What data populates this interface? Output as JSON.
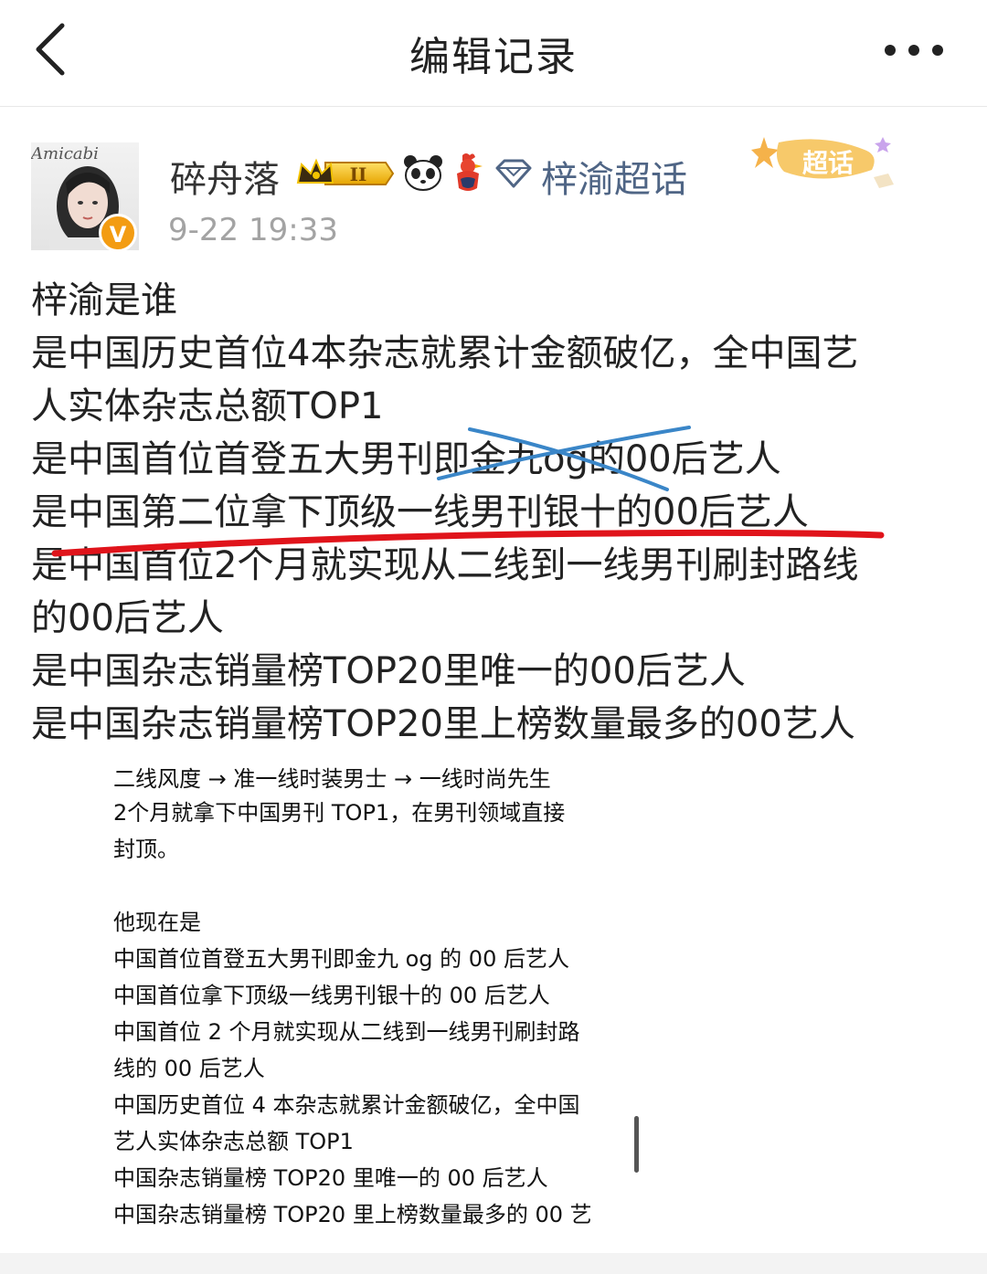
{
  "nav": {
    "title": "编辑记录",
    "back_icon": "chevron-left-icon",
    "more_icon": "more-dots-icon"
  },
  "post": {
    "avatar_text": "Amicabi",
    "verified_badge": "V",
    "username": "碎舟落",
    "level_badge": "II",
    "supertopic_label": "梓渝超话",
    "supertopic_sticker_label": "超话",
    "timestamp": "9-22 19:33",
    "accent_color": "#4f6585",
    "lines": [
      "梓渝是谁",
      "是中国历史首位4本杂志就累计金额破亿，全中国艺",
      "人实体杂志总额TOP1",
      "是中国首位首登五大男刊即金九og的00后艺人",
      "是中国第二位拿下顶级一线男刊银十的00后艺人",
      "是中国首位2个月就实现从二线到一线男刊刷封路线",
      "的00后艺人",
      "是中国杂志销量榜TOP20里唯一的00后艺人",
      "是中国杂志销量榜TOP20里上榜数量最多的00艺人"
    ]
  },
  "embedded": {
    "lines": [
      "二线风度 → 准一线时装男士 → 一线时尚先生",
      "2个月就拿下中国男刊 TOP1，在男刊领域直接",
      "封顶。",
      "",
      "他现在是",
      "中国首位首登五大男刊即金九 og 的 00 后艺人",
      "中国首位拿下顶级一线男刊银十的 00 后艺人",
      "中国首位 2 个月就实现从二线到一线男刊刷封路",
      "线的 00 后艺人",
      "中国历史首位 4 本杂志就累计金额破亿，全中国",
      "艺人实体杂志总额 TOP1",
      "中国杂志销量榜 TOP20 里唯一的 00 后艺人",
      "中国杂志销量榜 TOP20 里上榜数量最多的 00 艺"
    ]
  }
}
